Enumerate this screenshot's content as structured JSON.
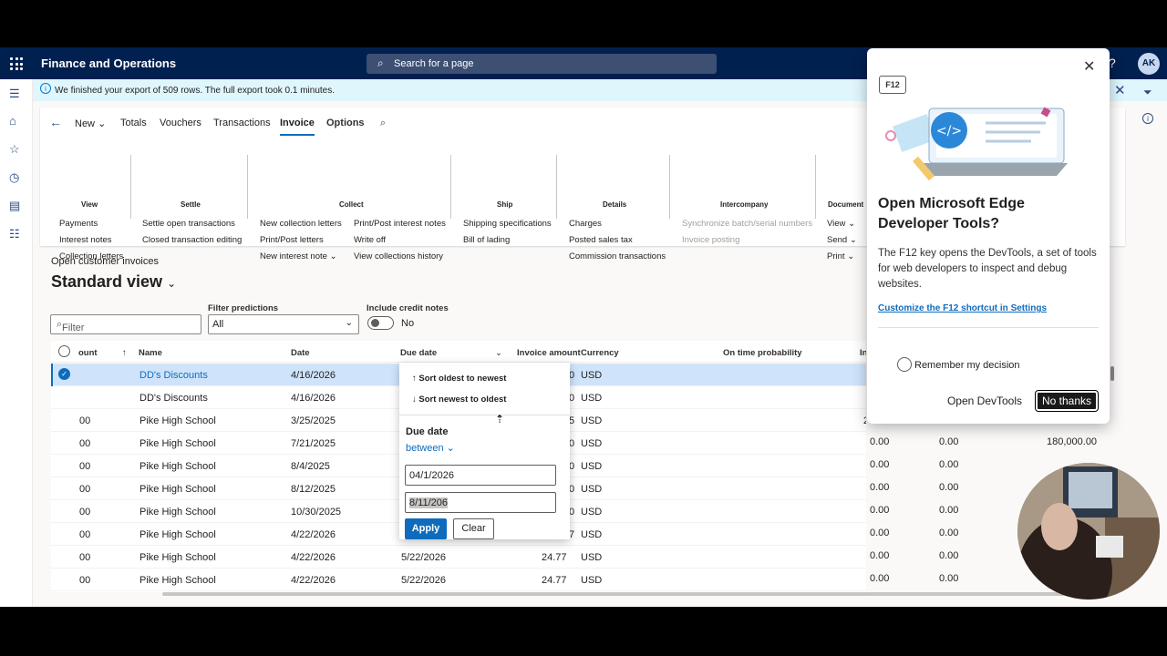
{
  "topbar": {
    "app_title": "Finance and Operations",
    "search_placeholder": "Search for a page",
    "help": "?",
    "avatar": "AK"
  },
  "infobar": {
    "message": "We finished your export of 509 rows. The full export took 0.1 minutes."
  },
  "ribbon": {
    "tabs": {
      "new": "New",
      "totals": "Totals",
      "vouchers": "Vouchers",
      "transactions": "Transactions",
      "invoice": "Invoice",
      "options": "Options"
    },
    "groups": {
      "view": {
        "head": "View",
        "items": [
          "Payments",
          "Interest notes",
          "Collection letters"
        ]
      },
      "settle": {
        "head": "Settle",
        "items": [
          "Settle open transactions",
          "Closed transaction editing"
        ]
      },
      "collect": {
        "head": "Collect",
        "items": [
          "New collection letters",
          "Print/Post letters",
          "New interest note",
          "Print/Post interest notes",
          "Write off",
          "View collections history"
        ]
      },
      "ship": {
        "head": "Ship",
        "items": [
          "Shipping specifications",
          "Bill of lading"
        ]
      },
      "details": {
        "head": "Details",
        "items": [
          "Charges",
          "Posted sales tax",
          "Commission transactions"
        ]
      },
      "intercompany": {
        "head": "Intercompany",
        "items": [
          "Synchronize batch/serial numbers",
          "Invoice posting"
        ]
      },
      "document": {
        "head": "Document",
        "items": [
          "View",
          "Send",
          "Print"
        ]
      }
    }
  },
  "page": {
    "subtitle": "Open customer invoices",
    "view_title": "Standard view"
  },
  "filters": {
    "filter_placeholder": "Filter",
    "predictions_label": "Filter predictions",
    "predictions_value": "All",
    "credit_label": "Include credit notes",
    "credit_value": "No"
  },
  "grid": {
    "headers": {
      "account": "ount",
      "name": "Name",
      "date": "Date",
      "due": "Due date",
      "amount": "Invoice amount",
      "currency": "Currency",
      "ontime": "On time probability",
      "more": "In"
    },
    "rows": [
      {
        "acct": "",
        "name": "DD's Discounts",
        "date": "4/16/2026",
        "due": "",
        "amt": "0",
        "cur": "USD",
        "c1": "",
        "c2": "",
        "c3": ""
      },
      {
        "acct": "",
        "name": "DD's Discounts",
        "date": "4/16/2026",
        "due": "",
        "amt": "0",
        "cur": "USD",
        "c1": "",
        "c2": "",
        "c3": ""
      },
      {
        "acct": "00",
        "name": "Pike High School",
        "date": "3/25/2025",
        "due": "",
        "amt": "5",
        "cur": "USD",
        "c1": "2",
        "c2": "",
        "c3": ""
      },
      {
        "acct": "00",
        "name": "Pike High School",
        "date": "7/21/2025",
        "due": "",
        "amt": "0",
        "cur": "USD",
        "c1": "0.00",
        "c2": "0.00",
        "c3": "180,000.00"
      },
      {
        "acct": "00",
        "name": "Pike High School",
        "date": "8/4/2025",
        "due": "",
        "amt": "0",
        "cur": "USD",
        "c1": "0.00",
        "c2": "0.00",
        "c3": ""
      },
      {
        "acct": "00",
        "name": "Pike High School",
        "date": "8/12/2025",
        "due": "",
        "amt": "0",
        "cur": "USD",
        "c1": "0.00",
        "c2": "0.00",
        "c3": ""
      },
      {
        "acct": "00",
        "name": "Pike High School",
        "date": "10/30/2025",
        "due": "",
        "amt": "0",
        "cur": "USD",
        "c1": "0.00",
        "c2": "0.00",
        "c3": ""
      },
      {
        "acct": "00",
        "name": "Pike High School",
        "date": "4/22/2026",
        "due": "",
        "amt": "7",
        "cur": "USD",
        "c1": "0.00",
        "c2": "0.00",
        "c3": ""
      },
      {
        "acct": "00",
        "name": "Pike High School",
        "date": "4/22/2026",
        "due": "5/22/2026",
        "amt": "24.77",
        "cur": "USD",
        "c1": "0.00",
        "c2": "0.00",
        "c3": ""
      },
      {
        "acct": "00",
        "name": "Pike High School",
        "date": "4/22/2026",
        "due": "5/22/2026",
        "amt": "24.77",
        "cur": "USD",
        "c1": "0.00",
        "c2": "0.00",
        "c3": ""
      }
    ]
  },
  "due_menu": {
    "sort_asc": "Sort oldest to newest",
    "sort_desc": "Sort newest to oldest",
    "field_label": "Due date",
    "operator": "between",
    "from": "04/1/2026",
    "to": "8/11/206",
    "apply": "Apply",
    "clear": "Clear"
  },
  "devtools_popup": {
    "badge": "F12",
    "title": "Open Microsoft Edge Developer Tools?",
    "body": "The F12 key opens the DevTools, a set of tools for web developers to inspect and debug websites.",
    "link": "Customize the F12 shortcut in Settings",
    "remember": "Remember my decision",
    "open": "Open DevTools",
    "decline": "No thanks"
  }
}
